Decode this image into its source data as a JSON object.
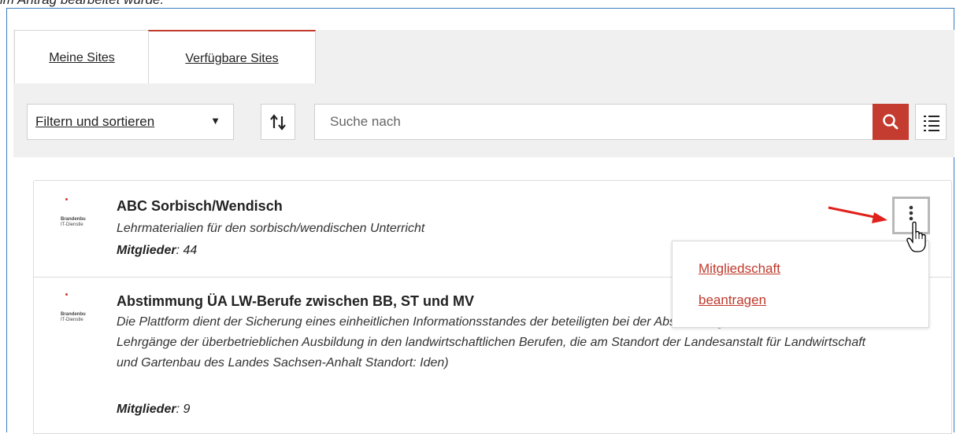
{
  "caption": "im Antrag bearbeitet wurde.",
  "tabs": [
    {
      "label": "Meine Sites"
    },
    {
      "label": "Verfügbare Sites"
    }
  ],
  "toolbar": {
    "filter_label": "Filtern und sortieren",
    "search_placeholder": "Suche nach",
    "search_icon": "magnifier-icon",
    "sort_icon": "sort-arrows-icon",
    "view_icon": "list-view-icon"
  },
  "sites": [
    {
      "logo_line1": "Brandenbu",
      "logo_line2": "IT-Dienstle",
      "title": "ABC Sorbisch/Wendisch",
      "description": "Lehrmaterialien für den sorbisch/wendischen Unterricht",
      "members_label": "Mitglieder",
      "members_value": ": 44"
    },
    {
      "logo_line1": "Brandenbu",
      "logo_line2": "IT-Dienstle",
      "title": "Abstimmung ÜA LW-Berufe zwischen BB, ST und MV",
      "description": "Die Plattform dient der Sicherung eines einheitlichen Informationsstandes der beteiligten bei der Abstimmung von Inhalten der Lehrgänge der überbetrieblichen Ausbildung in den landwirtschaftlichen Berufen, die am Standort der Landesanstalt für Landwirtschaft und Gartenbau des Landes Sachsen-Anhalt Standort: Iden)",
      "members_label": "Mitglieder",
      "members_value": ": 9"
    }
  ],
  "popup": {
    "line1": "Mitgliedschaft",
    "line2": "beantragen"
  },
  "colors": {
    "accent": "#c43b2f",
    "frame_border": "#3b7dc4",
    "panel_bg": "#f0f0f0"
  }
}
